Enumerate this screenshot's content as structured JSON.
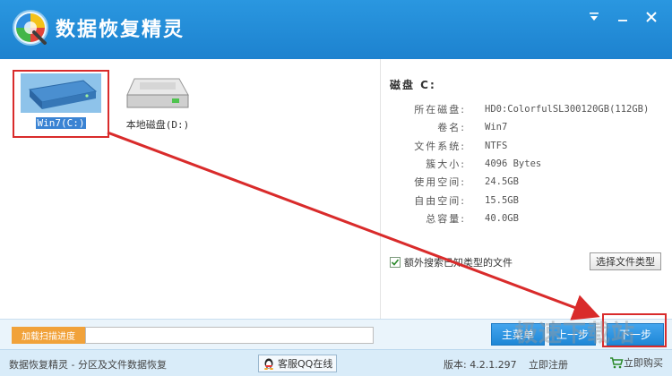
{
  "app": {
    "title": "数据恢复精灵"
  },
  "window_controls": {
    "menu_icon": "dropdown-menu-icon",
    "minimize_icon": "minimize-icon",
    "close_icon": "close-icon"
  },
  "disks": [
    {
      "label": "Win7(C:)",
      "icon": "hard-drive-blue-icon",
      "selected": true
    },
    {
      "label": "本地磁盘(D:)",
      "icon": "hard-drive-gray-icon",
      "selected": false
    }
  ],
  "info": {
    "title": "磁盘 C:",
    "rows": [
      {
        "key": "所在磁盘:",
        "value": "HD0:ColorfulSL300120GB(112GB)"
      },
      {
        "key": "卷名:",
        "value": "Win7"
      },
      {
        "key": "文件系统:",
        "value": "NTFS"
      },
      {
        "key": "簇大小:",
        "value": "4096 Bytes"
      },
      {
        "key": "使用空间:",
        "value": "24.5GB"
      },
      {
        "key": "自由空间:",
        "value": "15.5GB"
      },
      {
        "key": "总容量:",
        "value": "40.0GB"
      }
    ],
    "extra_scan_label": "额外搜索已知类型的文件",
    "extra_scan_checked": true,
    "file_type_button": "选择文件类型"
  },
  "actions": {
    "load_progress_label": "加载扫描进度",
    "main_menu_label": "主菜单",
    "prev_label": "上一步",
    "next_label": "下一步"
  },
  "status": {
    "app_desc": "数据恢复精灵 - 分区及文件数据恢复",
    "qq_service": "客服QQ在线",
    "version": "版本: 4.2.1.297",
    "register": "立即注册",
    "buy": "立即购买"
  },
  "watermark": "极速下载站",
  "colors": {
    "title_bar": "#1d82cf",
    "button_blue": "#1f87d6",
    "load_button": "#f1a23a",
    "highlight_red": "#d92b2b"
  }
}
